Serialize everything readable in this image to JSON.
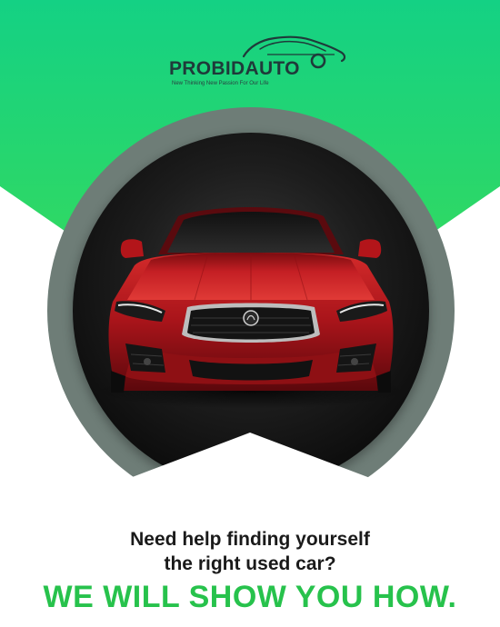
{
  "brand": {
    "name": "PROBIDAUTO",
    "tagline": "New Thinking New Passion For Our Life"
  },
  "headline": {
    "line1": "Need help finding yourself",
    "line2": "the right used car?",
    "cta": "WE WILL SHOW YOU HOW."
  },
  "icons": {
    "logo": "car-outline-icon",
    "emblem": "jaguar-emblem-icon"
  },
  "colors": {
    "green_top": "#19d38a",
    "green_bottom": "#35d85a",
    "ring": "#6e7d77",
    "car_red": "#b3151a",
    "cta_green": "#27c24c",
    "text_dark": "#1a1a1a"
  }
}
